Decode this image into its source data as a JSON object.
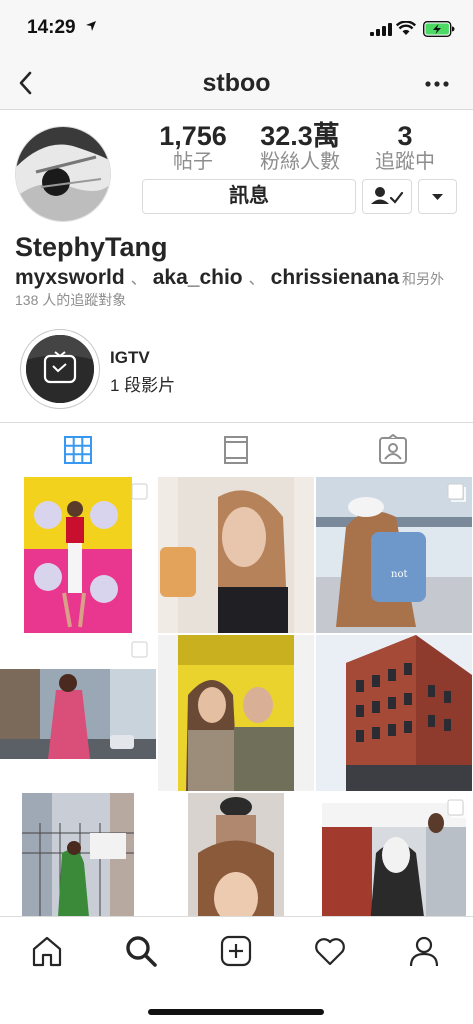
{
  "status_bar": {
    "time": "14:29"
  },
  "nav": {
    "title": "stboo"
  },
  "profile": {
    "stats": [
      {
        "value": "1,756",
        "label": "帖子"
      },
      {
        "value": "32.3萬",
        "label": "粉絲人數"
      },
      {
        "value": "3",
        "label": "追蹤中"
      }
    ],
    "message_button": "訊息",
    "name": "StephyTang",
    "followed_by": {
      "users": [
        "myxsworld",
        "aka_chio",
        "chrissienana"
      ],
      "separator": "、",
      "and_others": "和另外",
      "line2": "138 人的追蹤對象"
    }
  },
  "igtv": {
    "title": "IGTV",
    "count": "1 段影片"
  },
  "tabs": [
    {
      "icon": "grid-icon",
      "active": true
    },
    {
      "icon": "feed-list-icon",
      "active": false
    },
    {
      "icon": "tagged-icon",
      "active": false
    }
  ],
  "grid": {
    "posts": [
      {
        "icon": "multi-photo-icon",
        "multi": true,
        "scene": "poster-wall"
      },
      {
        "icon": "photo",
        "multi": false,
        "scene": "selfie-drink"
      },
      {
        "icon": "multi-photo-icon",
        "multi": true,
        "scene": "street-denim"
      },
      {
        "icon": "multi-photo-icon",
        "multi": true,
        "scene": "city-street"
      },
      {
        "icon": "photo",
        "multi": false,
        "scene": "two-people"
      },
      {
        "icon": "photo",
        "multi": false,
        "scene": "brick-building"
      },
      {
        "icon": "photo",
        "multi": false,
        "scene": "green-dress"
      },
      {
        "icon": "photo",
        "multi": false,
        "scene": "salon"
      },
      {
        "icon": "multi-photo-icon",
        "multi": true,
        "scene": "mask"
      }
    ]
  },
  "bottom_nav": [
    "home-icon",
    "search-icon",
    "new-post-icon",
    "activity-heart-icon",
    "profile-icon"
  ],
  "colors": {
    "text": "#262626",
    "secondary": "#8e8e8e",
    "active_tab": "#3897f0",
    "border": "#dbdbdb"
  }
}
